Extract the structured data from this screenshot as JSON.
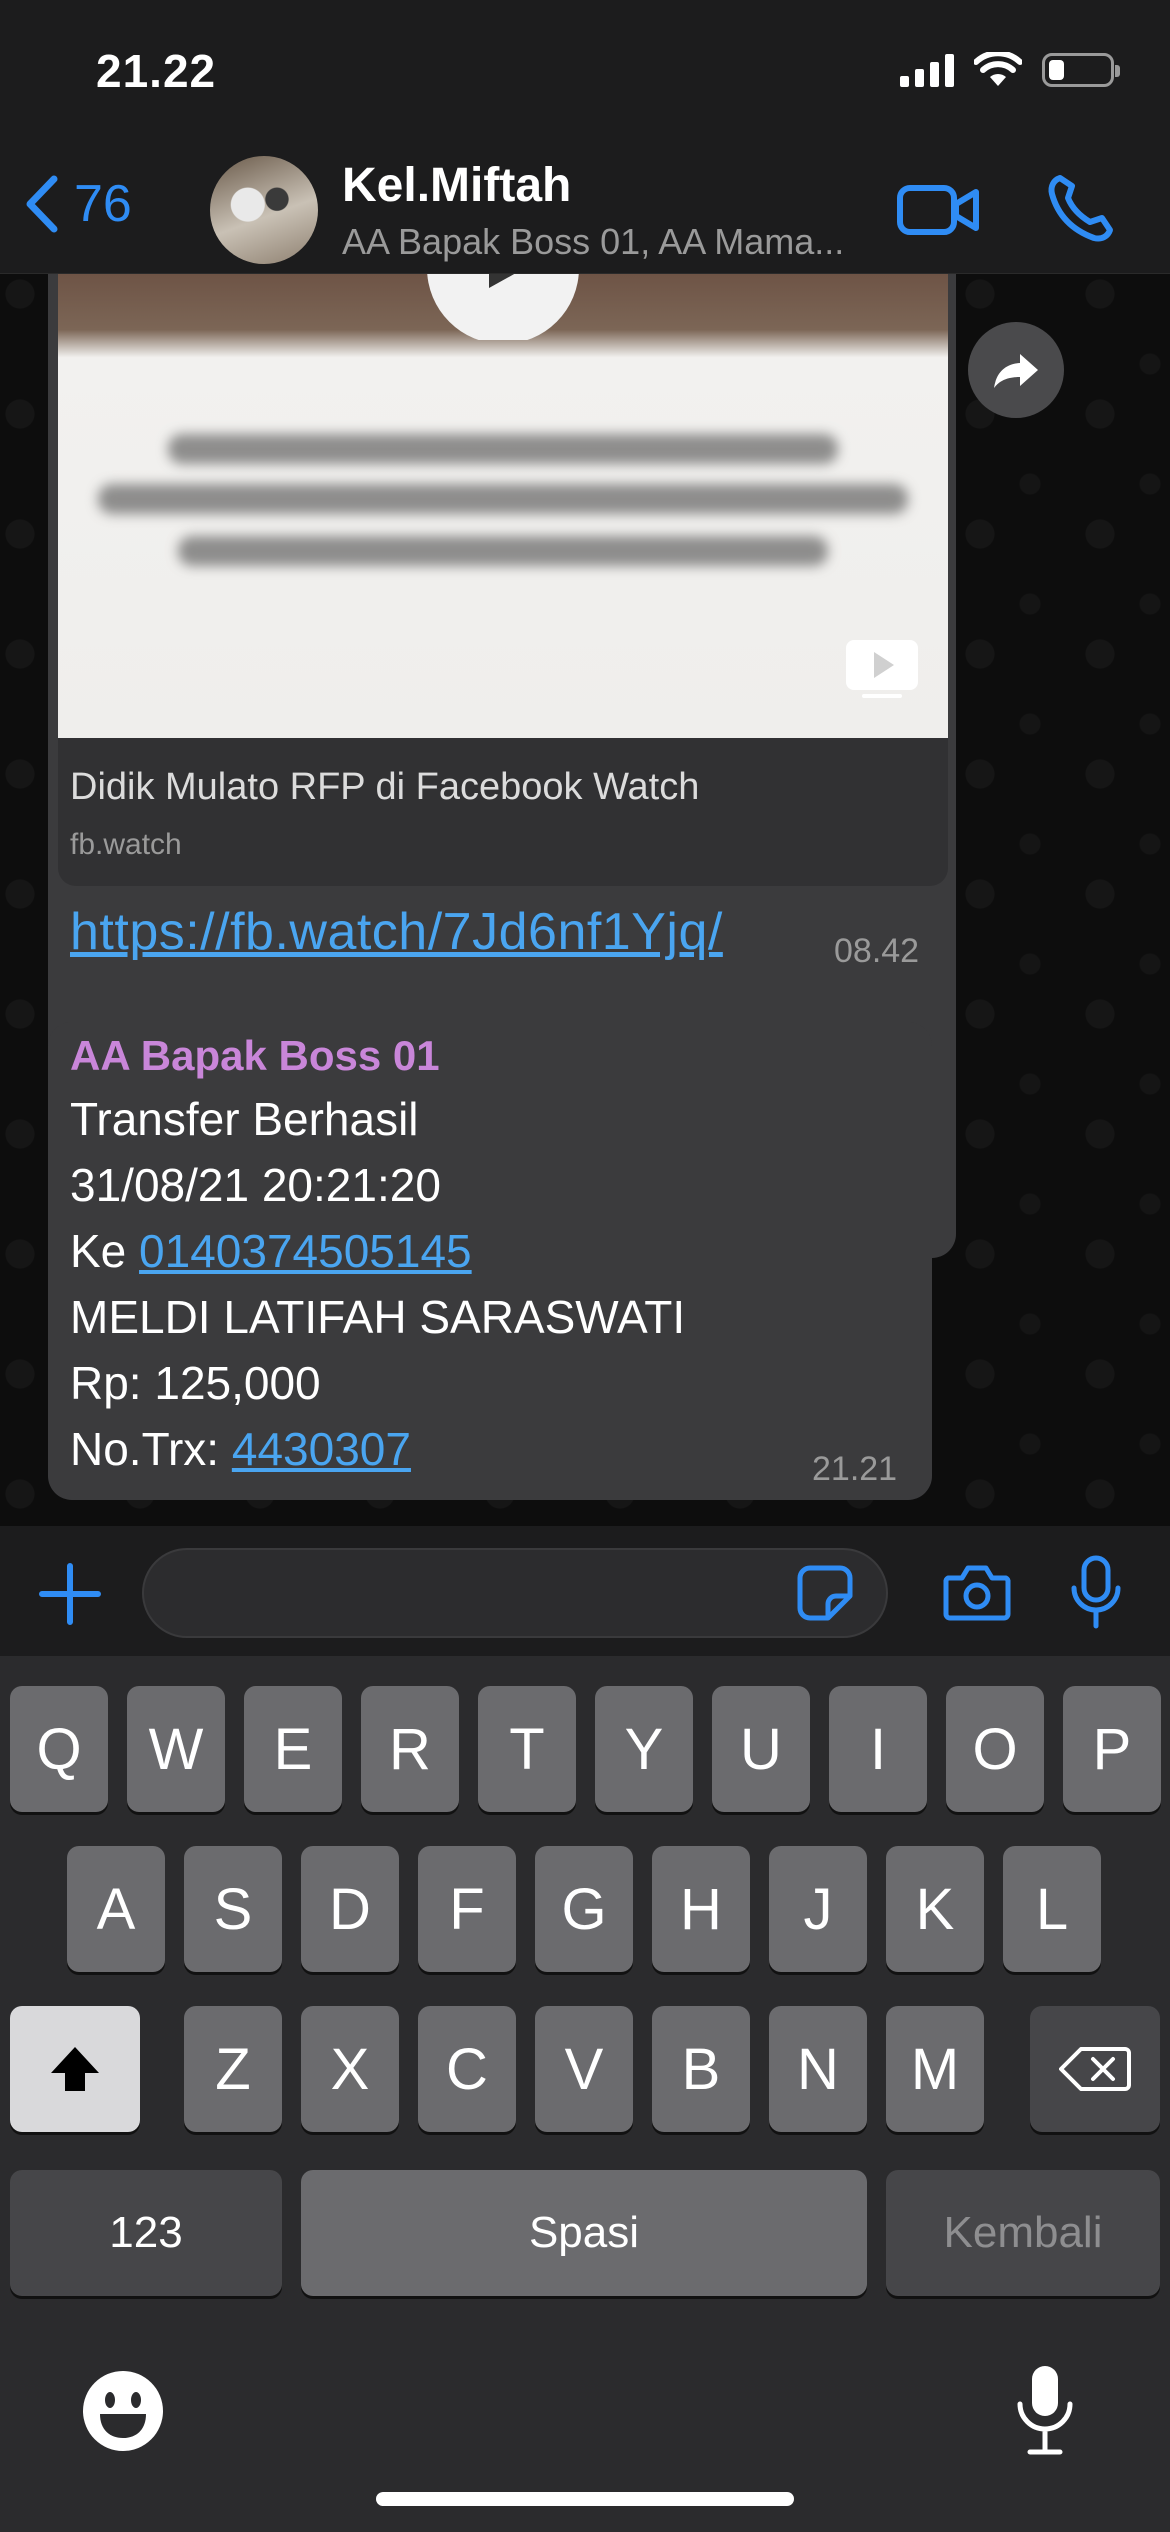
{
  "status_bar": {
    "time": "21.22",
    "battery_level_percent": 25
  },
  "header": {
    "back_count": "76",
    "title": "Kel.Miftah",
    "subtitle": "AA Bapak Boss 01, AA Mama..."
  },
  "message_1": {
    "link_preview_title": "Didik Mulato RFP di Facebook Watch",
    "link_preview_domain": "fb.watch",
    "url": "https://fb.watch/7Jd6nf1Yjq/",
    "time": "08.42"
  },
  "message_2": {
    "sender": "AA Bapak Boss 01",
    "line_1": "Transfer Berhasil",
    "line_2": "31/08/21 20:21:20",
    "line_3_prefix": "Ke ",
    "line_3_link": "0140374505145",
    "line_4": "MELDI LATIFAH SARASWATI",
    "line_5": "Rp: 125,000",
    "line_6_prefix": "No.Trx: ",
    "line_6_link": "4430307",
    "time": "21.21"
  },
  "input": {
    "value": "",
    "placeholder": ""
  },
  "keyboard": {
    "row1": [
      "Q",
      "W",
      "E",
      "R",
      "T",
      "Y",
      "U",
      "I",
      "O",
      "P"
    ],
    "row2": [
      "A",
      "S",
      "D",
      "F",
      "G",
      "H",
      "J",
      "K",
      "L"
    ],
    "row3": [
      "Z",
      "X",
      "C",
      "V",
      "B",
      "N",
      "M"
    ],
    "numbers_key": "123",
    "space_key": "Spasi",
    "return_key": "Kembali"
  },
  "colors": {
    "accent_blue": "#2f8cf4",
    "link_blue": "#4aa5f0",
    "sender_pink": "#c986d9",
    "bubble_gray": "#3b3b3d"
  },
  "icons": [
    "back-chevron-icon",
    "video-call-icon",
    "phone-icon",
    "forward-icon",
    "play-icon",
    "video-badge-icon",
    "plus-icon",
    "sticker-icon",
    "camera-icon",
    "microphone-icon",
    "shift-icon",
    "backspace-icon",
    "emoji-icon",
    "dictation-icon",
    "signal-icon",
    "wifi-icon",
    "battery-icon"
  ]
}
